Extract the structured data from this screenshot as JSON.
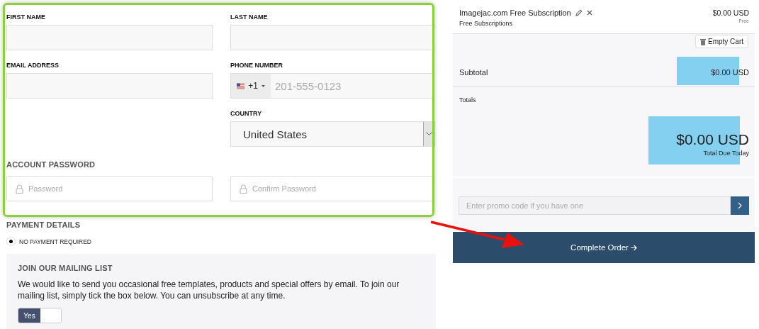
{
  "form": {
    "fields": [
      {
        "kind": "text",
        "label": "FIRST NAME"
      },
      {
        "kind": "text",
        "label": "LAST NAME"
      },
      {
        "kind": "text",
        "label": "EMAIL ADDRESS"
      },
      {
        "kind": "phone",
        "label": "PHONE NUMBER",
        "dial_code": "+1",
        "placeholder": "201-555-0123"
      },
      {
        "kind": "blank"
      },
      {
        "kind": "select",
        "label": "COUNTRY",
        "value": "United States"
      }
    ],
    "password_heading": "ACCOUNT PASSWORD",
    "password_fields": [
      {
        "placeholder": "Password"
      },
      {
        "placeholder": "Confirm Password"
      }
    ]
  },
  "payment": {
    "heading": "PAYMENT DETAILS",
    "options": [
      {
        "label": "NO PAYMENT REQUIRED",
        "selected": true
      }
    ]
  },
  "mailing_list": {
    "heading": "JOIN OUR MAILING LIST",
    "text": "We would like to send you occasional free templates, products and special offers by email. To join our mailing list, simply tick the box below. You can unsubscribe at any time.",
    "toggle": {
      "label": "Yes",
      "on": true
    }
  },
  "cart": {
    "items": [
      {
        "name": "Imagejac.com Free Subscription",
        "group": "Free Subscriptions",
        "price": "$0.00 USD",
        "cycle": "Free"
      }
    ],
    "empty_cart": "Empty Cart",
    "subtotal_label": "Subtotal",
    "subtotal": "$0.00 USD",
    "totals_label": "Totals",
    "total": "$0.00 USD",
    "total_caption": "Total Due Today",
    "promo": {
      "placeholder": "Enter promo code if you have one"
    },
    "checkout": "Complete Order"
  }
}
